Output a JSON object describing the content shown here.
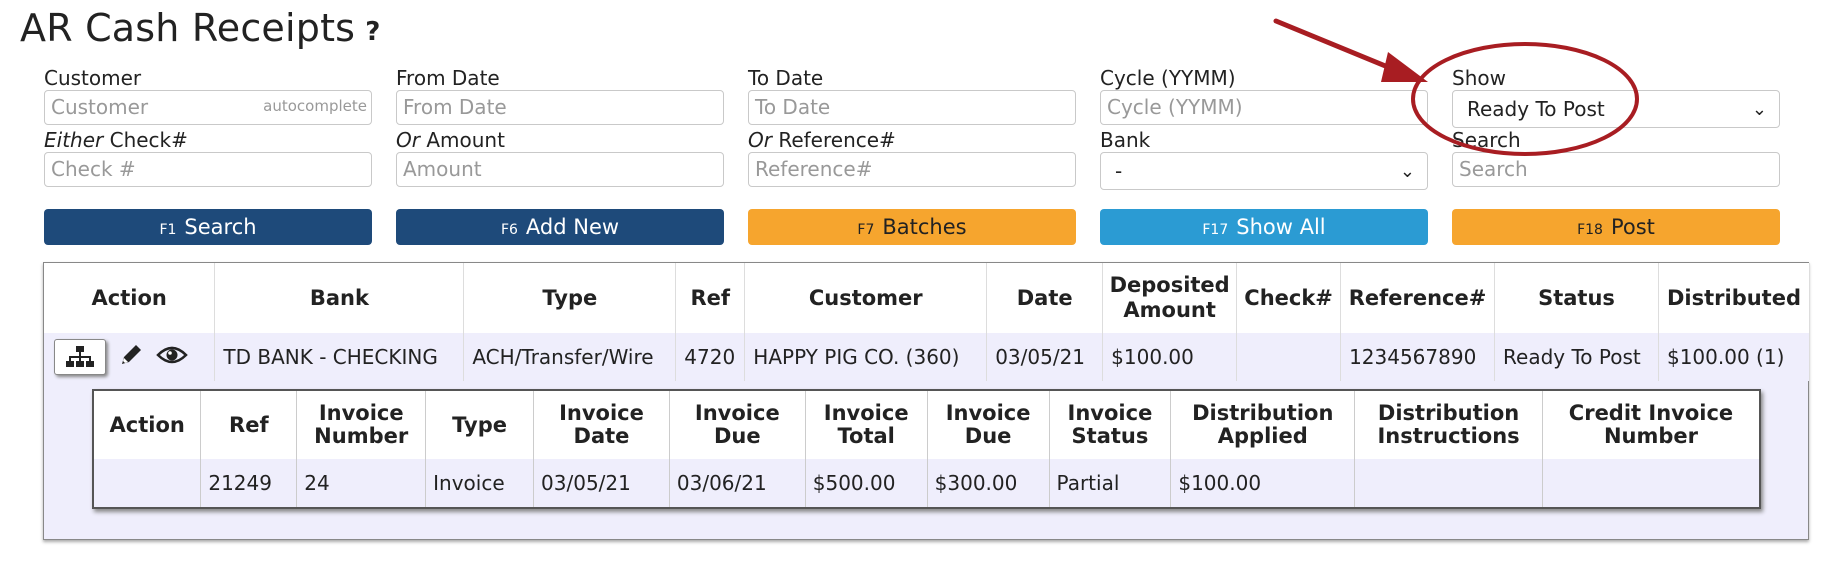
{
  "page": {
    "title": "AR Cash Receipts",
    "help_icon": "?"
  },
  "filters": {
    "customer": {
      "label": "Customer",
      "placeholder": "Customer",
      "hint": "autocomplete"
    },
    "from_date": {
      "label": "From Date",
      "placeholder": "From Date"
    },
    "to_date": {
      "label": "To Date",
      "placeholder": "To Date"
    },
    "cycle": {
      "label": "Cycle (YYMM)",
      "placeholder": "Cycle (YYMM)"
    },
    "show": {
      "label": "Show",
      "value": "Ready To Post"
    },
    "check": {
      "label_prefix": "Either",
      "label": " Check#",
      "placeholder": "Check #"
    },
    "amount": {
      "label_prefix": "Or",
      "label": " Amount",
      "placeholder": "Amount"
    },
    "reference": {
      "label_prefix": "Or",
      "label": " Reference#",
      "placeholder": "Reference#"
    },
    "bank": {
      "label": "Bank",
      "value": "-"
    },
    "search": {
      "label": "Search",
      "placeholder": "Search"
    }
  },
  "buttons": {
    "search": {
      "key": "F1",
      "label": "Search"
    },
    "add_new": {
      "key": "F6",
      "label": "Add New"
    },
    "batches": {
      "key": "F7",
      "label": "Batches"
    },
    "show_all": {
      "key": "F17",
      "label": "Show All"
    },
    "post": {
      "key": "F18",
      "label": "Post"
    }
  },
  "colors": {
    "navy": "#1e4a7a",
    "orange": "#f6a52e",
    "blue": "#2b9bd3",
    "annotation": "#a81d22"
  },
  "main_table": {
    "headers": [
      "Action",
      "Bank",
      "Type",
      "Ref",
      "Customer",
      "Date",
      "Deposited Amount",
      "Check#",
      "Reference#",
      "Status",
      "Distributed"
    ],
    "row": {
      "action_icons": [
        "sitemap-icon",
        "pencil-icon",
        "eye-icon"
      ],
      "bank": "TD BANK - CHECKING",
      "type": "ACH/Transfer/Wire",
      "ref": "4720",
      "customer": "HAPPY PIG CO. (360)",
      "date": "03/05/21",
      "deposited_amount": "$100.00",
      "check": "",
      "reference": "1234567890",
      "status": "Ready To Post",
      "distributed": "$100.00 (1)"
    }
  },
  "sub_table": {
    "headers": [
      "Action",
      "Ref",
      "Invoice Number",
      "Type",
      "Invoice Date",
      "Invoice Due",
      "Invoice Total",
      "Invoice Due",
      "Invoice Status",
      "Distribution Applied",
      "Distribution Instructions",
      "Credit Invoice Number"
    ],
    "row": {
      "action": "",
      "ref": "21249",
      "invoice_number": "24",
      "type": "Invoice",
      "invoice_date": "03/05/21",
      "invoice_due_date": "03/06/21",
      "invoice_total": "$500.00",
      "invoice_due": "$300.00",
      "invoice_status": "Partial",
      "distribution_applied": "$100.00",
      "distribution_instructions": "",
      "credit_invoice_number": ""
    }
  }
}
